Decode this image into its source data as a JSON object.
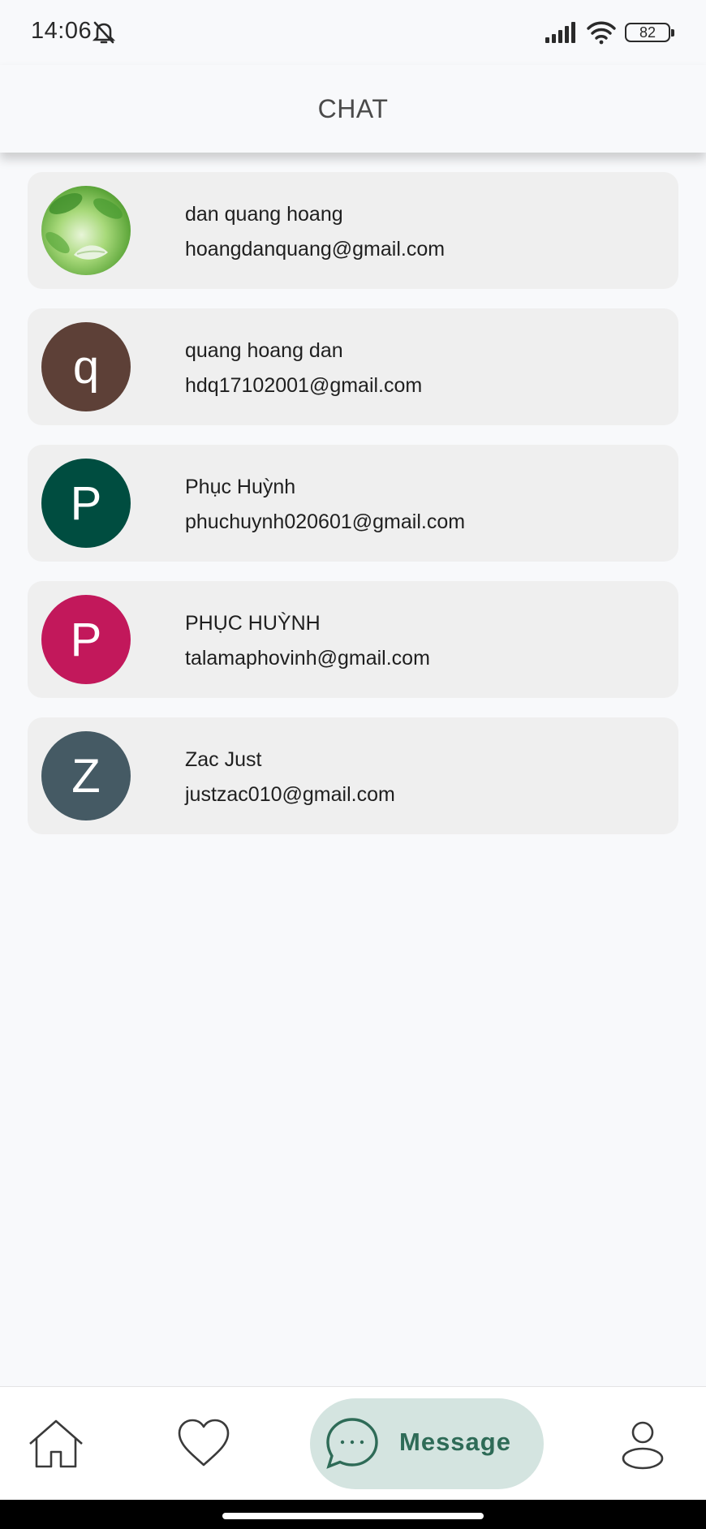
{
  "status_bar": {
    "time": "14:06",
    "battery": "82"
  },
  "app_bar": {
    "title": "CHAT"
  },
  "chats": [
    {
      "name": "dan quang hoang",
      "email": "hoangdanquang@gmail.com",
      "avatar_letter": "",
      "avatar_color": "#6fbf4a"
    },
    {
      "name": "quang hoang dan",
      "email": "hdq17102001@gmail.com",
      "avatar_letter": "q",
      "avatar_color": "#5d4037"
    },
    {
      "name": "Phục Huỳnh",
      "email": "phuchuynh020601@gmail.com",
      "avatar_letter": "P",
      "avatar_color": "#004d40"
    },
    {
      "name": "PHỤC HUỲNH",
      "email": "talamaphovinh@gmail.com",
      "avatar_letter": "P",
      "avatar_color": "#c2185b"
    },
    {
      "name": "Zac Just",
      "email": "justzac010@gmail.com",
      "avatar_letter": "Z",
      "avatar_color": "#455a64"
    }
  ],
  "bottom_nav": {
    "message_label": "Message",
    "active": "message",
    "accent_color": "#2e6b57"
  }
}
